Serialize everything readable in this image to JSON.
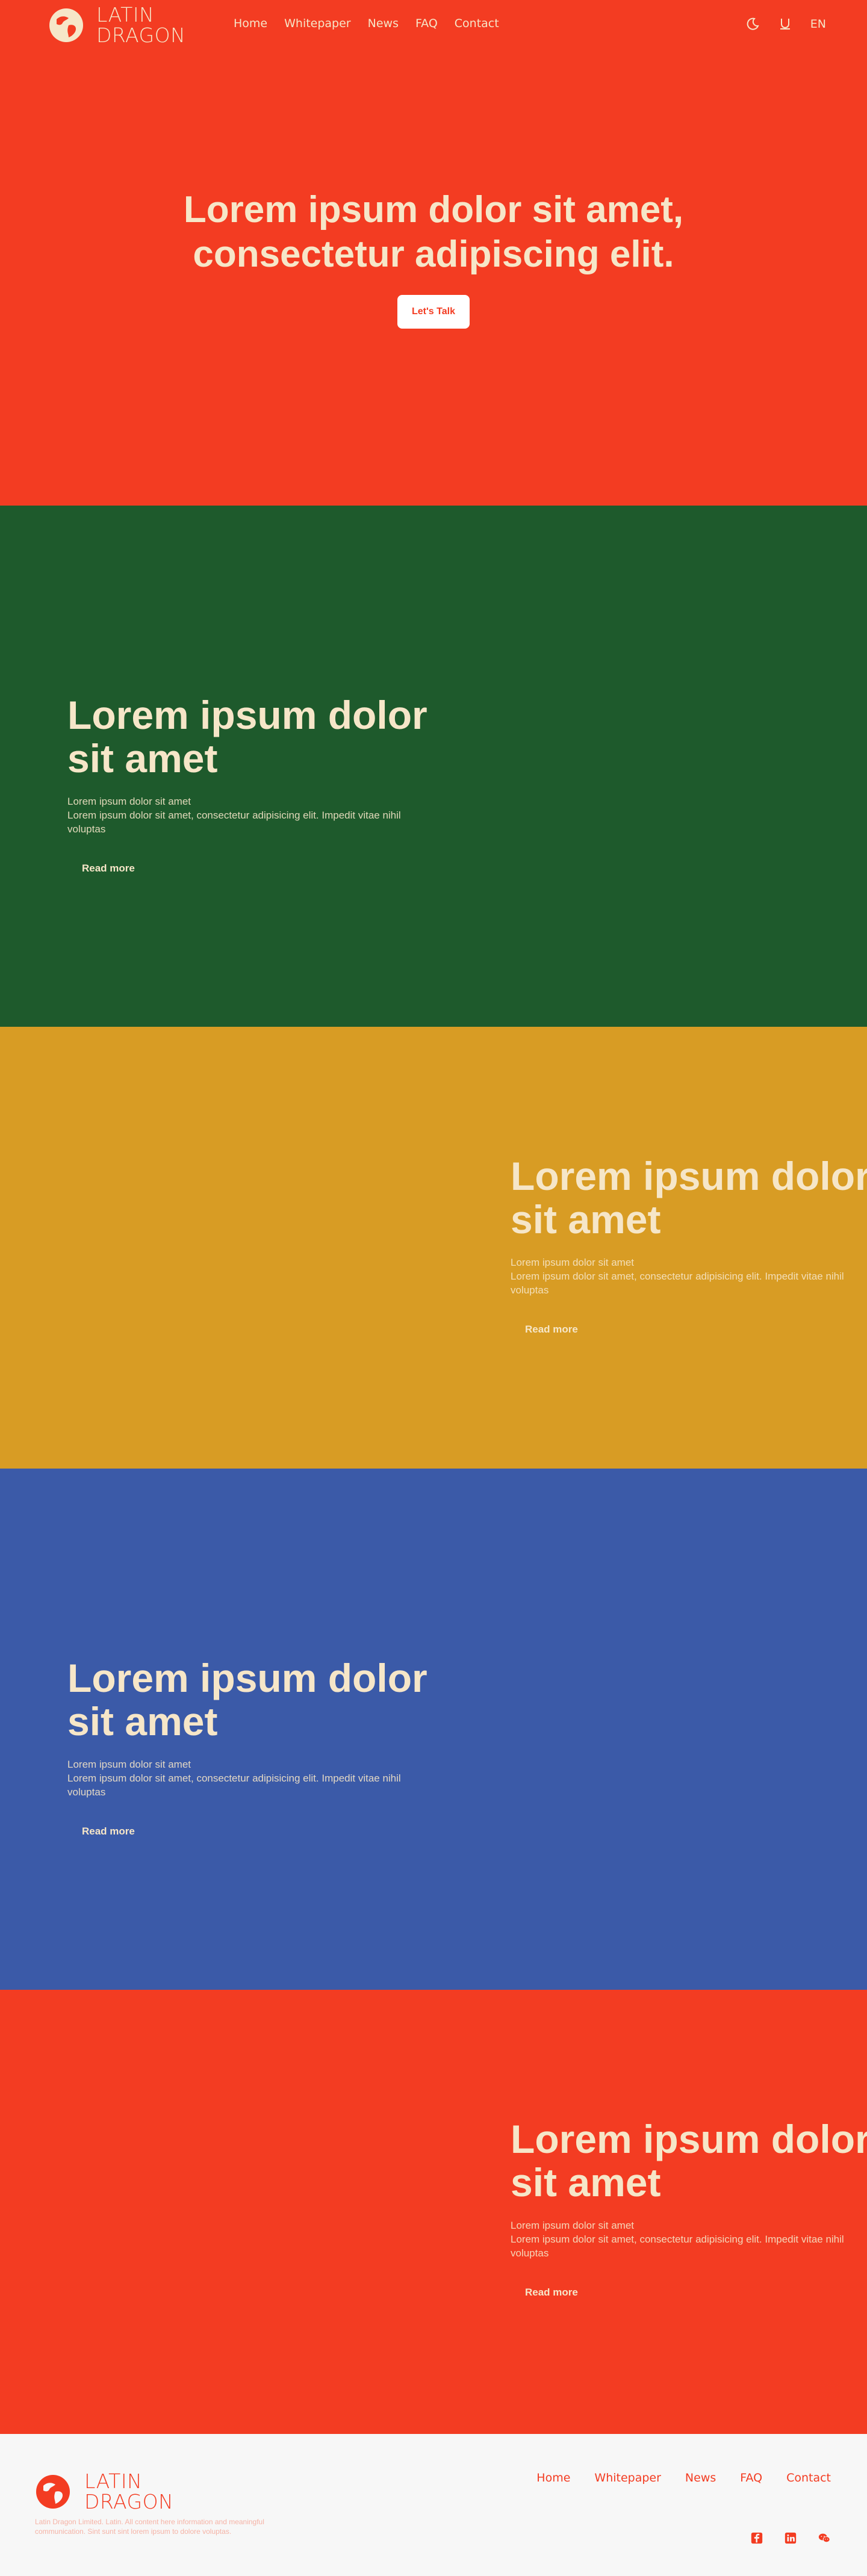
{
  "header": {
    "brand_line1": "LATIN",
    "brand_line2": "DRAGON",
    "nav": [
      "Home",
      "Whitepaper",
      "News",
      "FAQ",
      "Contact"
    ],
    "language": "EN",
    "icons": [
      "moon-icon",
      "magnet-icon"
    ]
  },
  "hero": {
    "title_line1": "Lorem ipsum dolor sit amet,",
    "title_line2": "consectetur adipiscing elit.",
    "cta": "Let's Talk"
  },
  "sections": [
    {
      "title_line1": "Lorem ipsum dolor",
      "title_line2": "sit amet",
      "subtitle": "Lorem ipsum dolor sit amet",
      "description": "Lorem ipsum dolor sit amet, consectetur adipisicing elit. Impedit vitae nihil voluptas",
      "button": "Read more",
      "bg": "#1e5a2c"
    },
    {
      "title_line1": "Lorem ipsum dolor",
      "title_line2": "sit amet",
      "subtitle": "Lorem ipsum dolor sit amet",
      "description": "Lorem ipsum dolor sit amet, consectetur adipisicing elit. Impedit vitae nihil voluptas",
      "button": "Read more",
      "bg": "#d89c24"
    },
    {
      "title_line1": "Lorem ipsum dolor",
      "title_line2": "sit amet",
      "subtitle": "Lorem ipsum dolor sit amet",
      "description": "Lorem ipsum dolor sit amet, consectetur adipisicing elit. Impedit vitae nihil voluptas",
      "button": "Read more",
      "bg": "#3b5aa8"
    },
    {
      "title_line1": "Lorem ipsum dolor",
      "title_line2": "sit amet",
      "subtitle": "Lorem ipsum dolor sit amet",
      "description": "Lorem ipsum dolor sit amet, consectetur adipisicing elit. Impedit vitae nihil voluptas",
      "button": "Read more",
      "bg": "#f33c22"
    }
  ],
  "footer": {
    "brand_line1": "LATIN",
    "brand_line2": "DRAGON",
    "copyright": "Latin Dragon Limited. Latin. All content here information and meaningful communication. Sint sunt sint lorem ipsum to dolore voluptas.",
    "nav": [
      "Home",
      "Whitepaper",
      "News",
      "FAQ",
      "Contact"
    ],
    "social_icons": [
      "facebook-icon",
      "linkedin-icon",
      "wechat-icon"
    ]
  },
  "colors": {
    "brand_red": "#f33c22",
    "cream": "#f6e6c8",
    "green": "#1e5a2c",
    "gold": "#d89c24",
    "blue": "#3b5aa8"
  }
}
